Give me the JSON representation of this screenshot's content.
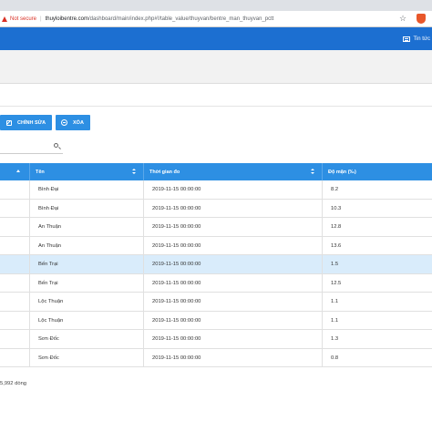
{
  "browser": {
    "not_secure": "Not secure",
    "url_host": "thuyloibentre.com",
    "url_path": "/dashboard/main/index.php#!/table_value/thuyvan/bentre_man_thuyvan_pctt"
  },
  "nav": {
    "news_label": "Tin tức"
  },
  "toolbar": {
    "edit_label": "CHỈNH SỬA",
    "delete_label": "XÓA"
  },
  "search": {
    "value": "",
    "placeholder": ""
  },
  "table": {
    "columns": [
      "",
      "Tên",
      "Thời gian đo",
      "Độ mặn (‰)"
    ],
    "rows": [
      {
        "name": "Bình Đại",
        "time": "2019-11-15 00:00:00",
        "salinity": "8.2",
        "selected": false
      },
      {
        "name": "Bình Đại",
        "time": "2019-11-15 00:00:00",
        "salinity": "10.3",
        "selected": false
      },
      {
        "name": "An Thuận",
        "time": "2019-11-15 00:00:00",
        "salinity": "12.8",
        "selected": false
      },
      {
        "name": "An Thuận",
        "time": "2019-11-15 00:00:00",
        "salinity": "13.6",
        "selected": false
      },
      {
        "name": "Bến Trại",
        "time": "2019-11-15 00:00:00",
        "salinity": "1.5",
        "selected": true
      },
      {
        "name": "Bến Trại",
        "time": "2019-11-15 00:00:00",
        "salinity": "12.5",
        "selected": false
      },
      {
        "name": "Lộc Thuận",
        "time": "2019-11-15 00:00:00",
        "salinity": "1.1",
        "selected": false
      },
      {
        "name": "Lộc Thuận",
        "time": "2019-11-15 00:00:00",
        "salinity": "1.1",
        "selected": false
      },
      {
        "name": "Sơn Đốc",
        "time": "2019-11-15 00:00:00",
        "salinity": "1.3",
        "selected": false
      },
      {
        "name": "Sơn Đốc",
        "time": "2019-11-15 00:00:00",
        "salinity": "0.8",
        "selected": false
      }
    ]
  },
  "footer": {
    "row_count": "5,992 dòng"
  },
  "colors": {
    "primary": "#1c6fd1",
    "button": "#2d8fe3",
    "selected_row": "#d9ecfb",
    "warning": "#d93025"
  }
}
